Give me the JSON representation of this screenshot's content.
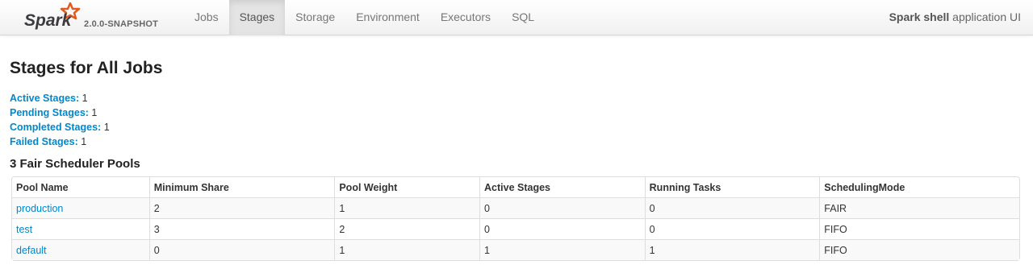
{
  "header": {
    "logo_text": "Spark",
    "version": "2.0.0-SNAPSHOT",
    "nav": [
      {
        "label": "Jobs",
        "active": false
      },
      {
        "label": "Stages",
        "active": true
      },
      {
        "label": "Storage",
        "active": false
      },
      {
        "label": "Environment",
        "active": false
      },
      {
        "label": "Executors",
        "active": false
      },
      {
        "label": "SQL",
        "active": false
      }
    ],
    "app_name": "Spark shell",
    "app_suffix": " application UI"
  },
  "page": {
    "title": "Stages for All Jobs",
    "summary": [
      {
        "label": "Active Stages:",
        "value": "1"
      },
      {
        "label": "Pending Stages:",
        "value": "1"
      },
      {
        "label": "Completed Stages:",
        "value": "1"
      },
      {
        "label": "Failed Stages:",
        "value": "1"
      }
    ],
    "pools_title": "3 Fair Scheduler Pools"
  },
  "pools_table": {
    "columns": [
      "Pool Name",
      "Minimum Share",
      "Pool Weight",
      "Active Stages",
      "Running Tasks",
      "SchedulingMode"
    ],
    "rows": [
      [
        "production",
        "2",
        "1",
        "0",
        "0",
        "FAIR"
      ],
      [
        "test",
        "3",
        "2",
        "0",
        "0",
        "FIFO"
      ],
      [
        "default",
        "0",
        "1",
        "1",
        "1",
        "FIFO"
      ]
    ]
  },
  "colors": {
    "link": "#0088cc",
    "logo_orange": "#e25a1c",
    "logo_text": "#3c3a3e"
  }
}
